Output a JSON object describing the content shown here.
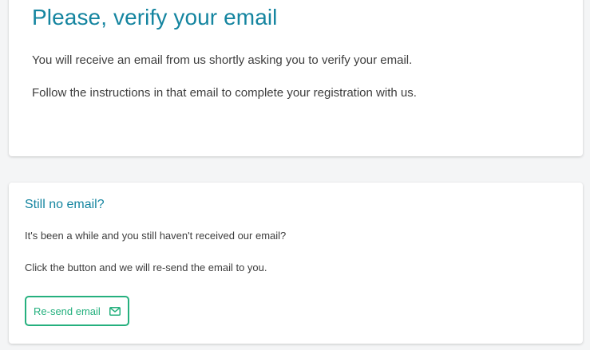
{
  "verify_card": {
    "title": "Please, verify your email",
    "paragraph_1": "You will receive an email from us shortly asking you to verify your email.",
    "paragraph_2": "Follow the instructions in that email to complete your registration with us."
  },
  "resend_card": {
    "title": "Still no email?",
    "paragraph_1": "It's been a while and you still haven't received our email?",
    "paragraph_2": "Click the button and we will re-send the email to you.",
    "button_label": "Re-send email",
    "button_icon": "envelope-icon"
  },
  "colors": {
    "heading": "#1585a0",
    "body_text": "#3d3d3d",
    "button_accent": "#25b07e",
    "page_background": "#f4f5f6"
  }
}
